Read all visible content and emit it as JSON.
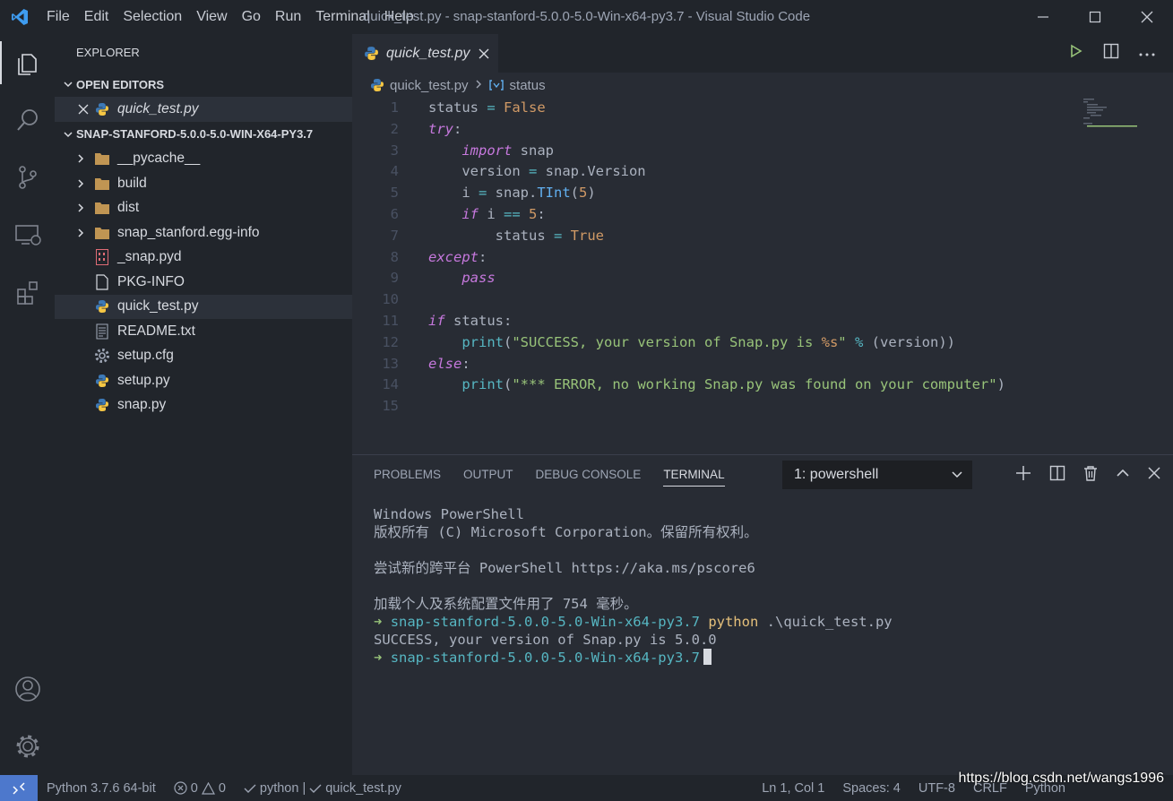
{
  "app": {
    "title": "quick_test.py - snap-stanford-5.0.0-5.0-Win-x64-py3.7 - Visual Studio Code",
    "menu": [
      "File",
      "Edit",
      "Selection",
      "View",
      "Go",
      "Run",
      "Terminal",
      "Help"
    ],
    "window_controls": {
      "minimize": "─",
      "maximize": "☐",
      "close": "✕"
    }
  },
  "activity_bar": {
    "items": [
      "explorer",
      "search",
      "source-control",
      "remote-explorer",
      "extensions"
    ],
    "bottom": [
      "accounts",
      "manage"
    ]
  },
  "sidebar": {
    "title": "EXPLORER",
    "open_editors_label": "OPEN EDITORS",
    "open_editors": [
      {
        "name": "quick_test.py",
        "icon": "python-icon"
      }
    ],
    "folder_label": "SNAP-STANFORD-5.0.0-5.0-WIN-X64-PY3.7",
    "tree": [
      {
        "name": "__pycache__",
        "type": "folder"
      },
      {
        "name": "build",
        "type": "folder"
      },
      {
        "name": "dist",
        "type": "folder"
      },
      {
        "name": "snap_stanford.egg-info",
        "type": "folder"
      },
      {
        "name": "_snap.pyd",
        "type": "binary"
      },
      {
        "name": "PKG-INFO",
        "type": "file"
      },
      {
        "name": "quick_test.py",
        "type": "python",
        "selected": true
      },
      {
        "name": "README.txt",
        "type": "text"
      },
      {
        "name": "setup.cfg",
        "type": "gear"
      },
      {
        "name": "setup.py",
        "type": "python"
      },
      {
        "name": "snap.py",
        "type": "python"
      }
    ]
  },
  "editor": {
    "tab_label": "quick_test.py",
    "breadcrumb": {
      "file": "quick_test.py",
      "symbol": "status"
    },
    "code": [
      [
        {
          "t": "status ",
          "c": "txt"
        },
        {
          "t": "=",
          "c": "op"
        },
        {
          "t": " ",
          "c": "txt"
        },
        {
          "t": "False",
          "c": "bool"
        }
      ],
      [
        {
          "t": "try",
          "c": "kw"
        },
        {
          "t": ":",
          "c": "txt"
        }
      ],
      [
        {
          "t": "    ",
          "c": "txt"
        },
        {
          "t": "import",
          "c": "kw"
        },
        {
          "t": " snap",
          "c": "txt"
        }
      ],
      [
        {
          "t": "    version ",
          "c": "txt"
        },
        {
          "t": "=",
          "c": "op"
        },
        {
          "t": " snap.Version",
          "c": "txt"
        }
      ],
      [
        {
          "t": "    i ",
          "c": "txt"
        },
        {
          "t": "=",
          "c": "op"
        },
        {
          "t": " snap.",
          "c": "txt"
        },
        {
          "t": "TInt",
          "c": "fn"
        },
        {
          "t": "(",
          "c": "txt"
        },
        {
          "t": "5",
          "c": "num"
        },
        {
          "t": ")",
          "c": "txt"
        }
      ],
      [
        {
          "t": "    ",
          "c": "txt"
        },
        {
          "t": "if",
          "c": "kw"
        },
        {
          "t": " i ",
          "c": "txt"
        },
        {
          "t": "==",
          "c": "op"
        },
        {
          "t": " ",
          "c": "txt"
        },
        {
          "t": "5",
          "c": "num"
        },
        {
          "t": ":",
          "c": "txt"
        }
      ],
      [
        {
          "t": "        status ",
          "c": "txt"
        },
        {
          "t": "=",
          "c": "op"
        },
        {
          "t": " ",
          "c": "txt"
        },
        {
          "t": "True",
          "c": "bool"
        }
      ],
      [
        {
          "t": "except",
          "c": "kw"
        },
        {
          "t": ":",
          "c": "txt"
        }
      ],
      [
        {
          "t": "    ",
          "c": "txt"
        },
        {
          "t": "pass",
          "c": "kw"
        }
      ],
      [],
      [
        {
          "t": "if",
          "c": "kw"
        },
        {
          "t": " status:",
          "c": "txt"
        }
      ],
      [
        {
          "t": "    ",
          "c": "txt"
        },
        {
          "t": "print",
          "c": "bi"
        },
        {
          "t": "(",
          "c": "txt"
        },
        {
          "t": "\"SUCCESS, your version of Snap.py is ",
          "c": "str"
        },
        {
          "t": "%s",
          "c": "bool"
        },
        {
          "t": "\"",
          "c": "str"
        },
        {
          "t": " ",
          "c": "txt"
        },
        {
          "t": "%",
          "c": "op"
        },
        {
          "t": " (version))",
          "c": "txt"
        }
      ],
      [
        {
          "t": "else",
          "c": "kw"
        },
        {
          "t": ":",
          "c": "txt"
        }
      ],
      [
        {
          "t": "    ",
          "c": "txt"
        },
        {
          "t": "print",
          "c": "bi"
        },
        {
          "t": "(",
          "c": "txt"
        },
        {
          "t": "\"*** ERROR, no working Snap.py was found on your computer\"",
          "c": "str"
        },
        {
          "t": ")",
          "c": "txt"
        }
      ],
      []
    ]
  },
  "panel": {
    "tabs": [
      "PROBLEMS",
      "OUTPUT",
      "DEBUG CONSOLE",
      "TERMINAL"
    ],
    "active_tab": "TERMINAL",
    "terminal_select": "1: powershell",
    "terminal": {
      "line1": "Windows PowerShell",
      "line2": "版权所有 (C) Microsoft Corporation。保留所有权利。",
      "line3": "尝试新的跨平台 PowerShell https://aka.ms/pscore6",
      "line4": "加载个人及系统配置文件用了 754 毫秒。",
      "prompt_arrow": "➜",
      "prompt_dir": "snap-stanford-5.0.0-5.0-Win-x64-py3.7",
      "cmd_exe": "python",
      "cmd_arg": ".\\quick_test.py",
      "output": "SUCCESS, your version of Snap.py is 5.0.0"
    }
  },
  "statusbar": {
    "interpreter": "Python 3.7.6 64-bit",
    "errors": "0",
    "warnings": "0",
    "task1": "python |",
    "task2": "quick_test.py",
    "position": "Ln 1, Col 1",
    "spaces": "Spaces: 4",
    "encoding": "UTF-8",
    "eol": "CRLF",
    "language": "Python"
  },
  "watermark": "https://blog.csdn.net/wangs1996"
}
